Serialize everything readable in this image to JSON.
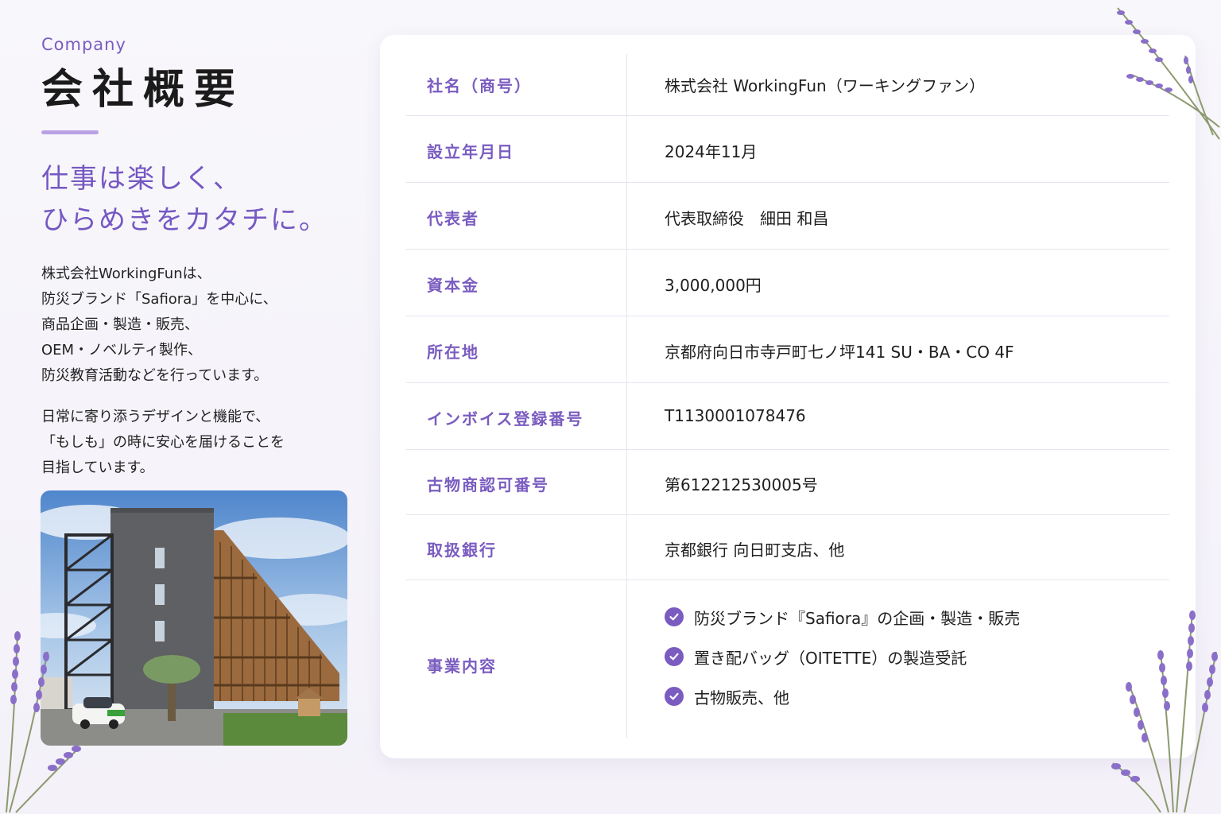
{
  "header": {
    "kicker": "Company",
    "title": "会社概要"
  },
  "catch": {
    "line1": "仕事は楽しく、",
    "line2": "ひらめきをカタチに。"
  },
  "intro": {
    "p1": [
      "株式会社WorkingFunは、",
      "防災ブランド「Safiora」を中心に、",
      "商品企画・製造・販売、",
      "OEM・ノベルティ製作、",
      "防災教育活動などを行っています。"
    ],
    "p2": [
      "日常に寄り添うデザインと機能で、",
      "「もしも」の時に安心を届けることを",
      "目指しています。"
    ]
  },
  "colors": {
    "accent": "#7a5cc0",
    "rule": "#b9a2e3",
    "background": "#f6f4fa"
  },
  "photo": {
    "icon": "building-photo"
  },
  "table": {
    "rows": [
      {
        "label": "社名（商号）",
        "value": "株式会社 WorkingFun（ワーキングファン）"
      },
      {
        "label": "設立年月日",
        "value": "2024年11月"
      },
      {
        "label": "代表者",
        "value": "代表取締役　細田 和昌"
      },
      {
        "label": "資本金",
        "value": "3,000,000円"
      },
      {
        "label": "所在地",
        "value": "京都府向日市寺戸町七ノ坪141 SU・BA・CO 4F"
      },
      {
        "label": "インボイス登録番号",
        "value": "T1130001078476"
      },
      {
        "label": "古物商認可番号",
        "value": "第612212530005号"
      },
      {
        "label": "取扱銀行",
        "value": "京都銀行 向日町支店、他"
      }
    ],
    "business": {
      "label": "事業内容",
      "items": [
        "防災ブランド『Safiora』の企画・製造・販売",
        "置き配バッグ（OITETTE）の製造受託",
        "古物販売、他"
      ],
      "icon": "check-circle-icon"
    }
  }
}
